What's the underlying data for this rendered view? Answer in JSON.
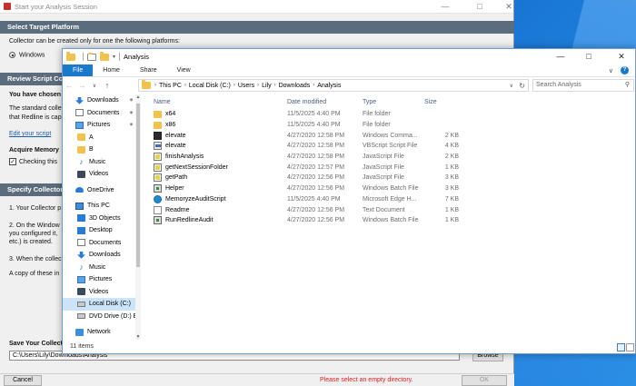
{
  "dialog": {
    "title": "Start your Analysis Session",
    "sections": {
      "platform": "Select Target Platform",
      "review": "Review Script Co",
      "specify": "Specify Collector L"
    },
    "platform_note": "Collector can be created only for one the following platforms:",
    "platform_option": "Windows",
    "review_heading": "You have chosen",
    "review_line1": "The standard colle",
    "review_line2": "that Redline is cap",
    "edit_link": "Edit your script",
    "acquire_label": "Acquire Memory",
    "checking_label": "Checking this",
    "step1": "1. Your Collector p",
    "step2a": "2. On the Window",
    "step2b": "you configured it,",
    "step2c": "etc.) is created.",
    "step3": "3. When the collec",
    "copy_note": "A copy of these in",
    "save_label": "Save Your Collect",
    "path_value": "C:\\Users\\Lily\\Downloads\\Analysis",
    "browse_label": "Browse",
    "cancel_label": "Cancel",
    "ok_label": "OK",
    "error_text": "Please select an empty directory."
  },
  "explorer": {
    "title": "Analysis",
    "tabs": [
      "File",
      "Home",
      "Share",
      "View"
    ],
    "breadcrumb": [
      "This PC",
      "Local Disk (C:)",
      "Users",
      "Lily",
      "Downloads",
      "Analysis"
    ],
    "search_placeholder": "Search Analysis",
    "sidebar": [
      {
        "label": "Downloads",
        "icon": "download-icon",
        "pinned": true
      },
      {
        "label": "Documents",
        "icon": "documents-icon",
        "pinned": true
      },
      {
        "label": "Pictures",
        "icon": "pictures-icon",
        "pinned": true
      },
      {
        "label": "A",
        "icon": "folder-icon"
      },
      {
        "label": "B",
        "icon": "folder-icon"
      },
      {
        "label": "Music",
        "icon": "music-icon"
      },
      {
        "label": "Videos",
        "icon": "videos-icon"
      },
      {
        "label": "OneDrive",
        "icon": "onedrive-icon"
      },
      {
        "label": "This PC",
        "icon": "this-pc-icon"
      },
      {
        "label": "3D Objects",
        "icon": "3d-objects-icon"
      },
      {
        "label": "Desktop",
        "icon": "desktop-icon"
      },
      {
        "label": "Documents",
        "icon": "documents-icon"
      },
      {
        "label": "Downloads",
        "icon": "download-icon"
      },
      {
        "label": "Music",
        "icon": "music-icon"
      },
      {
        "label": "Pictures",
        "icon": "pictures-icon"
      },
      {
        "label": "Videos",
        "icon": "videos-icon"
      },
      {
        "label": "Local Disk (C:)",
        "icon": "local-disk-icon",
        "selected": true
      },
      {
        "label": "DVD Drive (D:) E",
        "icon": "dvd-drive-icon"
      },
      {
        "label": "Network",
        "icon": "network-icon"
      }
    ],
    "columns": [
      "Name",
      "Date modified",
      "Type",
      "Size"
    ],
    "files": [
      {
        "name": "x64",
        "date": "11/5/2025 4:40 PM",
        "type": "File folder",
        "size": "",
        "icon": "folder"
      },
      {
        "name": "x86",
        "date": "11/5/2025 4:40 PM",
        "type": "File folder",
        "size": "",
        "icon": "folder"
      },
      {
        "name": "elevate",
        "date": "4/27/2020 12:58 PM",
        "type": "Windows Comma...",
        "size": "2 KB",
        "icon": "cmd"
      },
      {
        "name": "elevate",
        "date": "4/27/2020 12:58 PM",
        "type": "VBScript Script File",
        "size": "4 KB",
        "icon": "vbs"
      },
      {
        "name": "finishAnalysis",
        "date": "4/27/2020 12:58 PM",
        "type": "JavaScript File",
        "size": "2 KB",
        "icon": "js"
      },
      {
        "name": "getNextSessionFolder",
        "date": "4/27/2020 12:57 PM",
        "type": "JavaScript File",
        "size": "1 KB",
        "icon": "js"
      },
      {
        "name": "getPath",
        "date": "4/27/2020 12:56 PM",
        "type": "JavaScript File",
        "size": "3 KB",
        "icon": "js"
      },
      {
        "name": "Helper",
        "date": "4/27/2020 12:56 PM",
        "type": "Windows Batch File",
        "size": "3 KB",
        "icon": "bat"
      },
      {
        "name": "MemoryzeAuditScript",
        "date": "11/5/2025 4:40 PM",
        "type": "Microsoft Edge H...",
        "size": "7 KB",
        "icon": "edge"
      },
      {
        "name": "Readme",
        "date": "4/27/2020 12:56 PM",
        "type": "Text Document",
        "size": "1 KB",
        "icon": "txt"
      },
      {
        "name": "RunRedlineAudit",
        "date": "4/27/2020 12:56 PM",
        "type": "Windows Batch File",
        "size": "1 KB",
        "icon": "bat"
      }
    ],
    "status": "11 items"
  }
}
